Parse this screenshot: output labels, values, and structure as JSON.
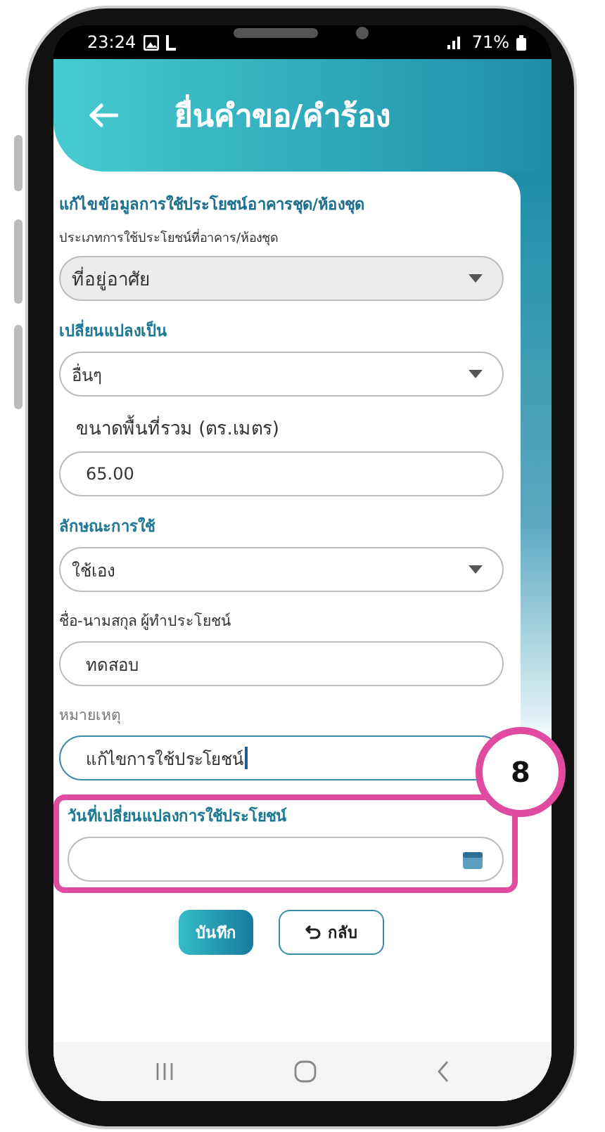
{
  "status_bar": {
    "time": "23:24",
    "battery": "71%"
  },
  "header": {
    "title": "ยื่นคำขอ/คำร้อง"
  },
  "form": {
    "section_title": "แก้ไขข้อมูลการใช้ประโยชน์อาคารชุด/ห้องชุด",
    "fields": [
      {
        "kind": "select",
        "label": {
          "kind": "small",
          "text": "ประเภทการใช้ประโยชน์ที่อาคาร/ห้องชุด"
        },
        "value": "ที่อยู่อาศัย",
        "disabled": true,
        "focused": false
      },
      {
        "kind": "select",
        "label": {
          "kind": "accent",
          "text": "เปลี่ยนแปลงเป็น"
        },
        "value": "อื่นๆ",
        "disabled": false,
        "focused": false
      },
      {
        "kind": "text",
        "label": {
          "kind": "large",
          "text": "ขนาดพื้นที่รวม (ตร.เมตร)"
        },
        "value": "65.00",
        "disabled": false,
        "focused": false
      },
      {
        "kind": "select",
        "label": {
          "kind": "accent",
          "text": "ลักษณะการใช้"
        },
        "value": "ใช้เอง",
        "disabled": false,
        "focused": false
      },
      {
        "kind": "text",
        "label": {
          "kind": "plain",
          "text": "ชื่อ-นามสกุล ผู้ทำประโยชน์"
        },
        "value": "ทดสอบ",
        "disabled": false,
        "focused": false
      },
      {
        "kind": "text",
        "label": {
          "kind": "muted",
          "text": "หมายเหตุ"
        },
        "value": "แก้ไขการใช้ประโยชน์",
        "disabled": false,
        "focused": true
      },
      {
        "kind": "date",
        "label": {
          "kind": "accent",
          "text": "วันที่เปลี่ยนแปลงการใช้ประโยชน์"
        },
        "disabled": false,
        "focused": false,
        "annotation": "8"
      }
    ]
  },
  "buttons": [
    {
      "kind": "primary",
      "label": "บันทึก"
    },
    {
      "kind": "back",
      "label": "กลับ"
    }
  ]
}
